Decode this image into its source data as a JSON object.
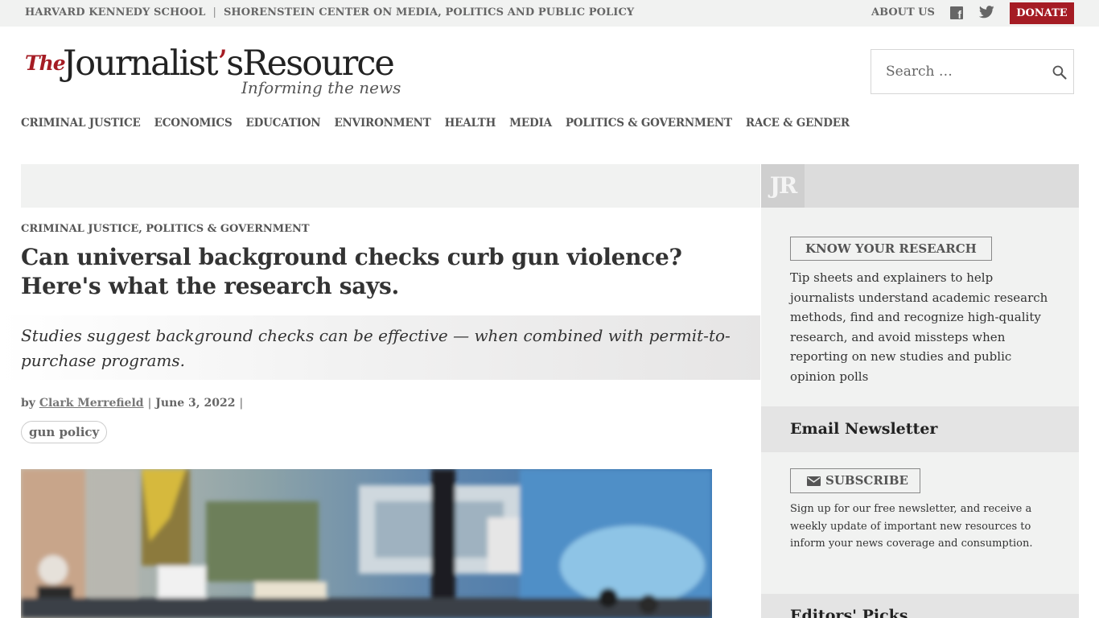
{
  "topbar": {
    "school": "HARVARD KENNEDY SCHOOL",
    "separator": "|",
    "center": "SHORENSTEIN CENTER ON MEDIA, POLITICS AND PUBLIC POLICY",
    "about": "ABOUT US",
    "facebook_icon": "facebook-icon",
    "twitter_icon": "twitter-icon",
    "donate": "DONATE"
  },
  "logo": {
    "the": "The",
    "name_part1": "Journalist",
    "apostrophe": "’",
    "name_part2": "sResource",
    "tagline": "Informing the news"
  },
  "search": {
    "placeholder": "Search …",
    "icon": "search-icon"
  },
  "nav": {
    "items": [
      "CRIMINAL JUSTICE",
      "ECONOMICS",
      "EDUCATION",
      "ENVIRONMENT",
      "HEALTH",
      "MEDIA",
      "POLITICS & GOVERNMENT",
      "RACE & GENDER"
    ]
  },
  "article": {
    "categories": "CRIMINAL JUSTICE, POLITICS & GOVERNMENT",
    "headline": "Can universal background checks curb gun violence? Here's what the research says.",
    "dek": "Studies suggest background checks can be effective — when combined with permit-to-purchase programs.",
    "by": "by",
    "author": "Clark Merrefield",
    "pipe": "|",
    "date": "June 3, 2022",
    "tag": "gun policy"
  },
  "sidebar": {
    "logo_mark": "JR",
    "know_your_research": "KNOW YOUR RESEARCH",
    "kyr_description": "Tip sheets and explainers to help journalists understand academic research methods, find and recognize high-quality research, and avoid missteps when reporting on new studies and public opinion polls",
    "newsletter_heading": "Email Newsletter",
    "subscribe_icon": "envelope-icon",
    "subscribe": "SUBSCRIBE",
    "newsletter_description": "Sign up for our free newsletter, and receive a weekly update of important new resources to inform your news coverage and consumption.",
    "editors_picks": "Editors' Picks"
  },
  "colors": {
    "accent": "#a51c24",
    "topbar_bg": "#f1f2f1",
    "sidebar_bg": "#f1f2f1"
  }
}
